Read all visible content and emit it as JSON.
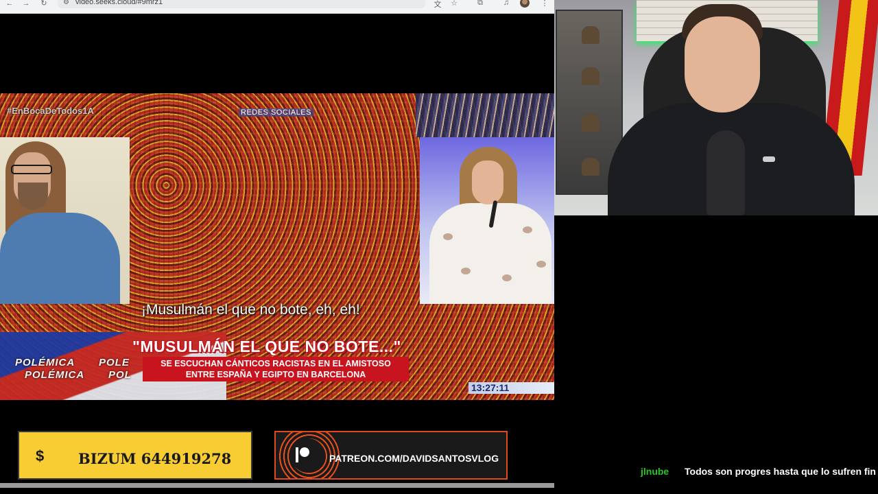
{
  "browser": {
    "url": "video.seeks.cloud/#9mrz1"
  },
  "video": {
    "hashtag": "#EnBocaDeTodos1A",
    "section_label": "REDES SOCIALES",
    "subtitle": "¡Musulmán el que no bote, eh, eh!",
    "polemica_labels": [
      "POLÉMICA",
      "POLE",
      "POLÉMICA",
      "POL"
    ],
    "headline": "\"MUSULMÁN EL QUE NO BOTE...\"",
    "subheadline_line1": "SE ESCUCHAN CÁNTICOS RACISTAS EN EL AMISTOSO",
    "subheadline_line2": "ENTRE ESPAÑA Y EGIPTO EN BARCELONA",
    "clock": "13:27:11"
  },
  "donations": {
    "bizum_symbol": "$",
    "bizum_text": "BIZUM 644919278",
    "patreon_text": "PATREON.COM/DAVIDSANTOSVLOG"
  },
  "chat": {
    "username": "jlnube",
    "message": "Todos son progres hasta que lo sufren fin"
  },
  "colors": {
    "bizum_yellow": "#f7cd33",
    "patreon_orange": "#e04a1e",
    "headline_red": "#c8141e",
    "chat_user_green": "#26c424"
  }
}
